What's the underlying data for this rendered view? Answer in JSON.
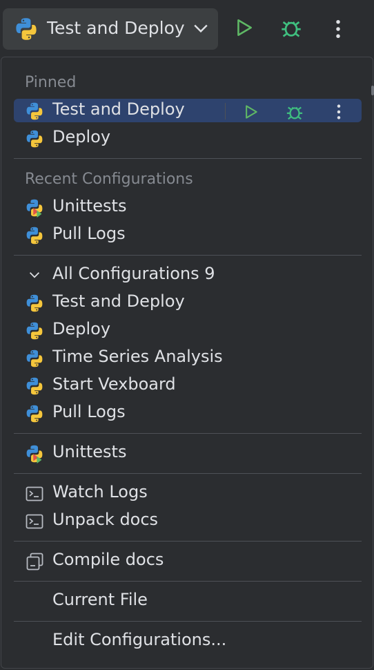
{
  "toolbar": {
    "config_label": "Test and Deploy",
    "icons": [
      "python-icon",
      "chevron-down-icon",
      "run-icon",
      "debug-icon",
      "more-vertical-icon"
    ],
    "colors": {
      "run": "#5fb865",
      "debug": "#3fbf7f"
    }
  },
  "pinned": {
    "title": "Pinned",
    "items": [
      {
        "label": "Test and Deploy",
        "icon": "python-icon",
        "selected": true
      },
      {
        "label": "Deploy",
        "icon": "python-icon"
      }
    ]
  },
  "recent": {
    "title": "Recent Configurations",
    "items": [
      {
        "label": "Unittests",
        "icon": "python-test-icon"
      },
      {
        "label": "Pull Logs",
        "icon": "python-icon"
      }
    ]
  },
  "all": {
    "title": "All Configurations",
    "count": "9",
    "items": [
      {
        "label": "Test and Deploy",
        "icon": "python-icon"
      },
      {
        "label": "Deploy",
        "icon": "python-icon"
      },
      {
        "label": "Time Series Analysis",
        "icon": "python-icon"
      },
      {
        "label": "Start Vexboard",
        "icon": "python-icon"
      },
      {
        "label": "Pull Logs",
        "icon": "python-icon"
      }
    ]
  },
  "extra": {
    "unittests": "Unittests",
    "watch_logs": "Watch Logs",
    "unpack_docs": "Unpack docs",
    "compile_docs": "Compile docs",
    "current_file": "Current File",
    "edit_configurations": "Edit Configurations..."
  }
}
